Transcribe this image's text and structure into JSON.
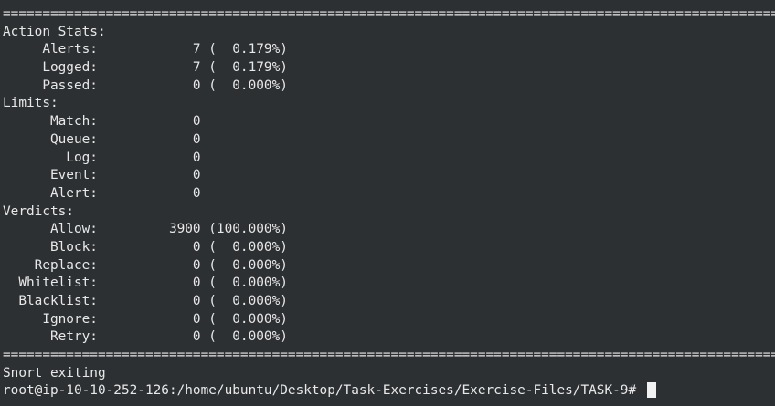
{
  "terminal": {
    "separator_top": "==================================================================================================",
    "action_stats": {
      "heading": "Action Stats:",
      "rows": [
        "     Alerts:            7 (  0.179%)",
        "     Logged:            7 (  0.179%)",
        "     Passed:            0 (  0.000%)"
      ]
    },
    "limits": {
      "heading": "Limits:",
      "rows": [
        "      Match:            0",
        "      Queue:            0",
        "        Log:            0",
        "      Event:            0",
        "      Alert:            0"
      ]
    },
    "verdicts": {
      "heading": "Verdicts:",
      "rows": [
        "      Allow:         3900 (100.000%)",
        "      Block:            0 (  0.000%)",
        "    Replace:            0 (  0.000%)",
        "  Whitelist:            0 (  0.000%)",
        "  Blacklist:            0 (  0.000%)",
        "     Ignore:            0 (  0.000%)",
        "      Retry:            0 (  0.000%)"
      ]
    },
    "separator_bottom": "==================================================================================================",
    "exit_message": "Snort exiting",
    "prompt": "root@ip-10-10-252-126:/home/ubuntu/Desktop/Task-Exercises/Exercise-Files/TASK-9# "
  }
}
